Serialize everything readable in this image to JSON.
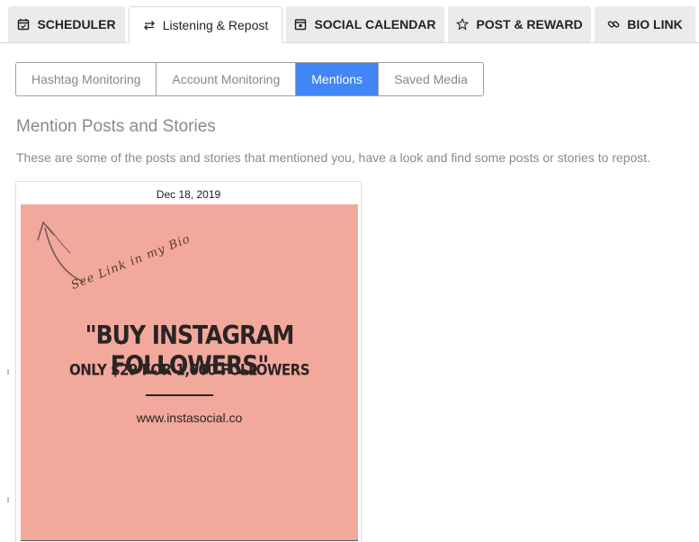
{
  "tabs": [
    {
      "label": "SCHEDULER",
      "icon": "calendar-check-icon"
    },
    {
      "label": "Listening & Repost",
      "icon": "repost-icon"
    },
    {
      "label": "SOCIAL CALENDAR",
      "icon": "calendar-icon"
    },
    {
      "label": "POST & REWARD",
      "icon": "star-icon"
    },
    {
      "label": "BIO LINK",
      "icon": "link-icon"
    }
  ],
  "subtabs": [
    "Hashtag Monitoring",
    "Account Monitoring",
    "Mentions",
    "Saved Media"
  ],
  "section": {
    "heading": "Mention Posts and Stories",
    "description": "These are some of the posts and stories that mentioned you, have a look and find some posts or stories to repost."
  },
  "card": {
    "date": "Dec 18, 2019",
    "media": {
      "script_text": "See Link in my Bio",
      "title": "\"BUY INSTAGRAM FOLLOWERS\"",
      "subtitle": "ONLY $29 FOR 1,000 FOLLOWERS",
      "url": "www.instasocial.co"
    }
  },
  "colors": {
    "accent": "#4285f4",
    "media_bg": "#f3a89c",
    "tab_bg": "#ebebeb"
  }
}
